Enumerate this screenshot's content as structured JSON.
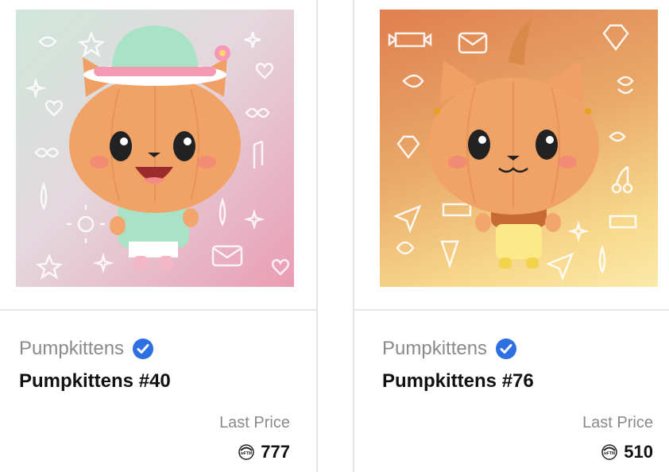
{
  "cards": [
    {
      "collection": "Pumpkittens",
      "title": "Pumpkittens #40",
      "last_price_label": "Last Price",
      "price": "777",
      "token_icon": "wftm-token-icon",
      "verified_icon": "verified-check-icon"
    },
    {
      "collection": "Pumpkittens",
      "title": "Pumpkittens #76",
      "last_price_label": "Last Price",
      "price": "510",
      "token_icon": "wftm-token-icon",
      "verified_icon": "verified-check-icon"
    }
  ],
  "colors": {
    "verified": "#2f6fe4",
    "muted_text": "#8a8a8a",
    "title_text": "#111111"
  }
}
